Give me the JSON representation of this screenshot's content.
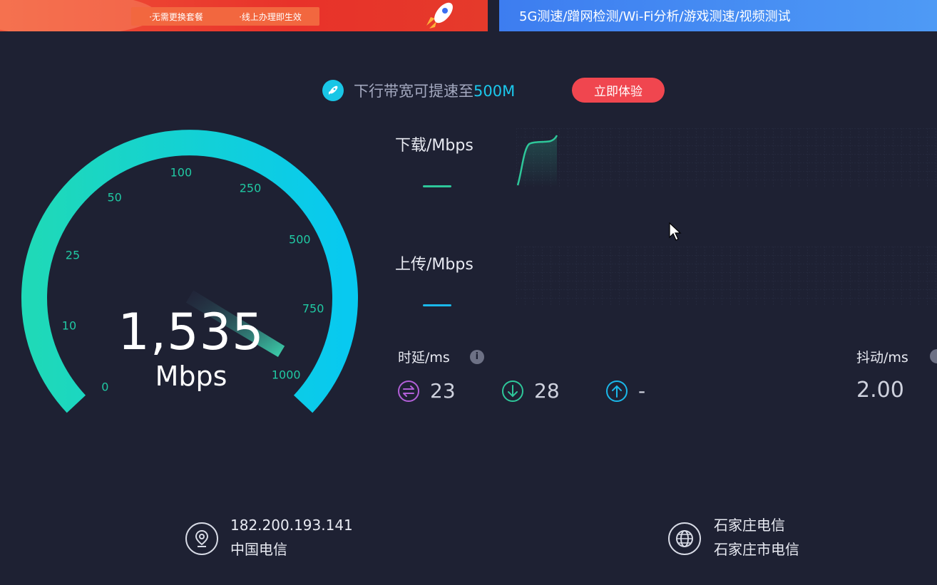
{
  "banner_left": {
    "tag1": "·无需更换套餐",
    "tag2": "·线上办理即生效"
  },
  "banner_right": {
    "text": "5G测速/蹭网检测/Wi-Fi分析/游戏测速/视频测试"
  },
  "promo": {
    "text": "下行带宽可提速至",
    "highlight": "500M",
    "button": "立即体验"
  },
  "gauge": {
    "ticks": [
      "0",
      "10",
      "25",
      "50",
      "100",
      "250",
      "500",
      "750",
      "1000"
    ],
    "value": "1,535",
    "unit": "Mbps",
    "needle_fraction": 0.97
  },
  "download": {
    "label": "下载/Mbps"
  },
  "upload": {
    "label": "上传/Mbps"
  },
  "latency": {
    "label": "时延/ms",
    "idle": "23",
    "download": "28",
    "upload": "-"
  },
  "jitter": {
    "label": "抖动/ms",
    "value": "2.00"
  },
  "footer": {
    "ip": "182.200.193.141",
    "isp": "中国电信",
    "server": "石家庄电信",
    "server_sub": "石家庄市电信"
  },
  "colors": {
    "background": "#1e2133",
    "gauge_start": "#1fd9b8",
    "gauge_end": "#08c9f0",
    "accent_red": "#f0464f",
    "download_line": "#2ec79a",
    "upload_line": "#1ab8ea"
  }
}
